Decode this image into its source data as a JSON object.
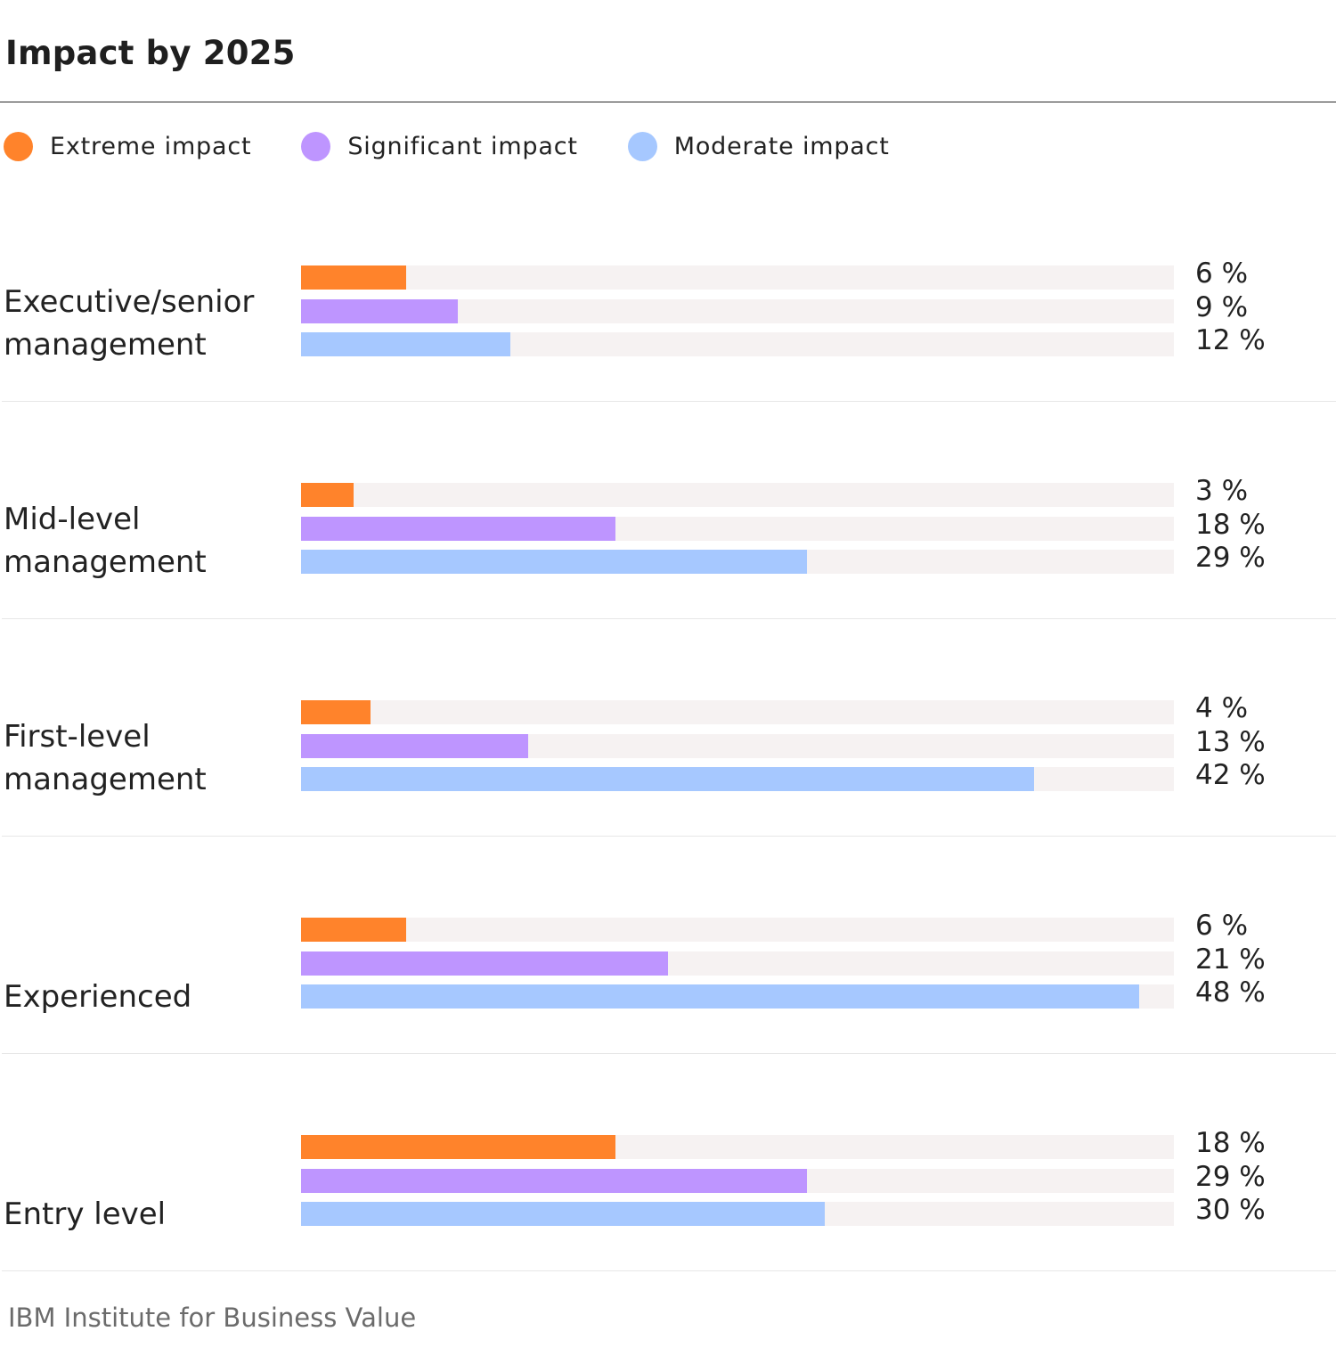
{
  "chart_data": {
    "type": "bar",
    "orientation": "horizontal",
    "title": "Impact by 2025",
    "xlabel": "",
    "ylabel": "",
    "xlim": [
      0,
      50
    ],
    "grid": false,
    "legend_position": "top-left",
    "value_suffix": " %",
    "categories": [
      "Executive/senior management",
      "Mid-level management",
      "First-level management",
      "Experienced",
      "Entry level"
    ],
    "category_lines": [
      [
        "Executive/senior",
        "management"
      ],
      [
        "Mid-level",
        "management"
      ],
      [
        "First-level",
        "management"
      ],
      [
        "Experienced"
      ],
      [
        "Entry level"
      ]
    ],
    "series": [
      {
        "name": "Extreme  impact",
        "color": "#ff832b",
        "values": [
          6,
          3,
          4,
          6,
          18
        ]
      },
      {
        "name": "Significant impact",
        "color": "#be95ff",
        "values": [
          9,
          18,
          13,
          21,
          29
        ]
      },
      {
        "name": "Moderate impact",
        "color": "#a6c8ff",
        "values": [
          12,
          29,
          42,
          48,
          30
        ]
      }
    ],
    "track_color": "#f6f2f2",
    "source": "IBM Institute for Business Value"
  }
}
